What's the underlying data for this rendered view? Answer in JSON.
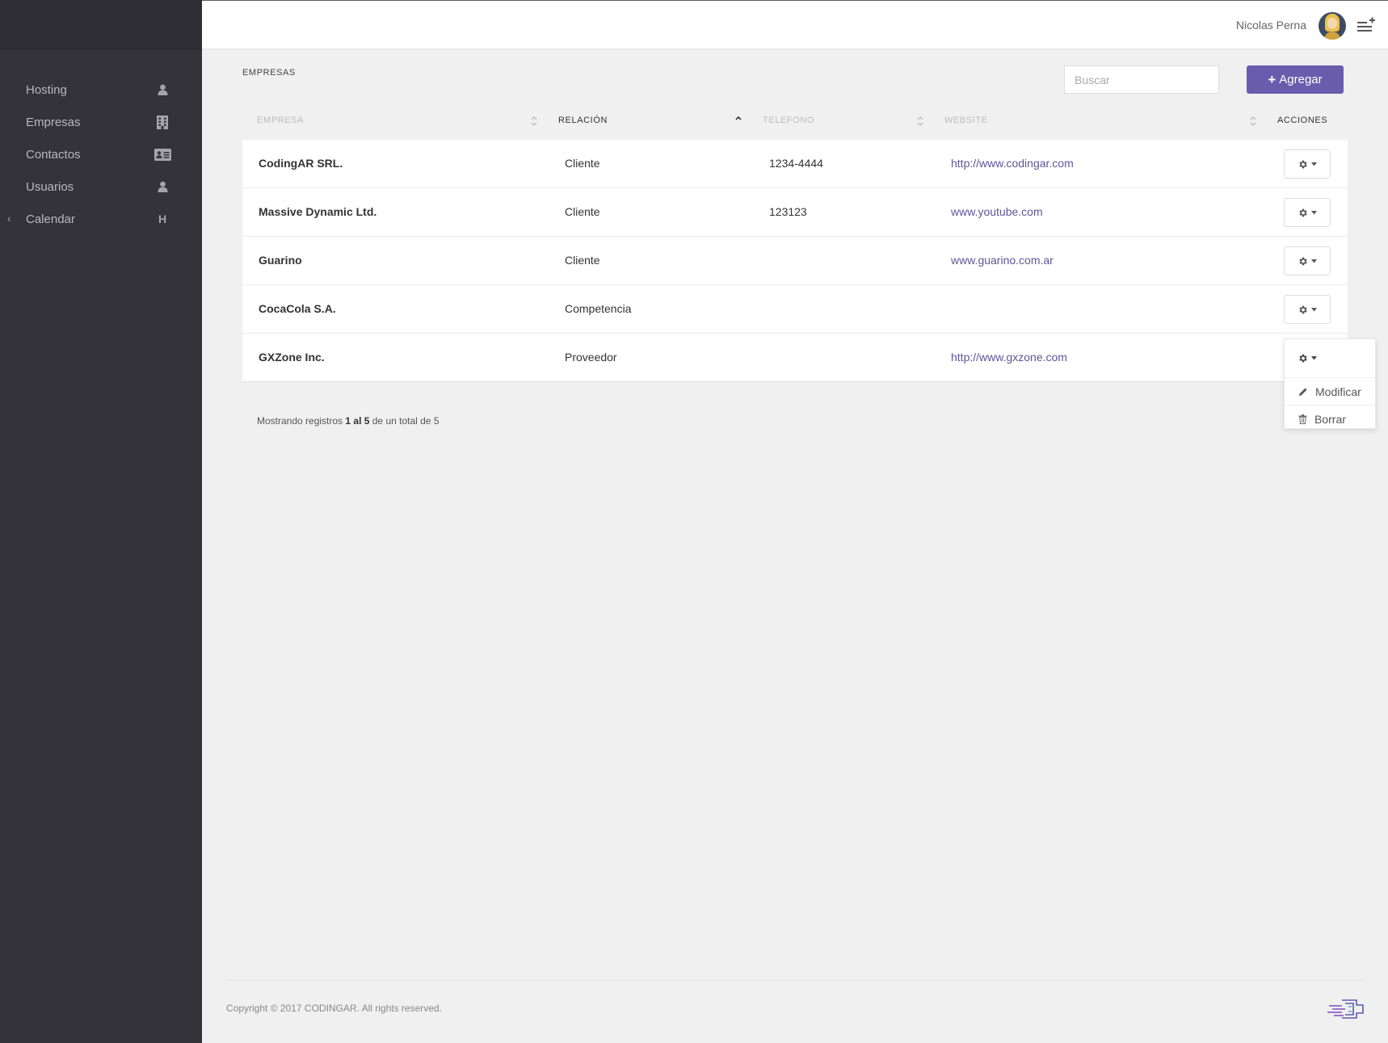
{
  "user": {
    "name": "Nicolas Perna"
  },
  "sidebar": {
    "items": [
      {
        "label": "Hosting",
        "icon": "user-icon"
      },
      {
        "label": "Empresas",
        "icon": "building-icon"
      },
      {
        "label": "Contactos",
        "icon": "address-card-icon"
      },
      {
        "label": "Usuarios",
        "icon": "user-icon"
      },
      {
        "label": "Calendar",
        "icon": "letter-h-icon",
        "icon_text": "H",
        "caret": "‹"
      }
    ]
  },
  "page": {
    "title": "EMPRESAS",
    "search_placeholder": "Buscar",
    "add_label": "Agregar",
    "add_icon": "+"
  },
  "table": {
    "headers": {
      "empresa": "EMPRESA",
      "relacion": "RELACIÓN",
      "telefono": "TELEFONO",
      "website": "WEBSITE",
      "acciones": "ACCIONES"
    },
    "sorted_column": "relacion",
    "sort_direction": "ascending",
    "rows": [
      {
        "empresa": "CodingAR SRL.",
        "relacion": "Cliente",
        "telefono": "1234-4444",
        "website": "http://www.codingar.com"
      },
      {
        "empresa": "Massive Dynamic Ltd.",
        "relacion": "Cliente",
        "telefono": "123123",
        "website": "www.youtube.com"
      },
      {
        "empresa": "Guarino",
        "relacion": "Cliente",
        "telefono": "",
        "website": "www.guarino.com.ar"
      },
      {
        "empresa": "CocaCola S.A.",
        "relacion": "Competencia",
        "telefono": "",
        "website": ""
      },
      {
        "empresa": "GXZone Inc.",
        "relacion": "Proveedor",
        "telefono": "",
        "website": "http://www.gxzone.com"
      }
    ],
    "open_dropdown_row": 4
  },
  "actions_menu": {
    "modify_label": "Modificar",
    "delete_label": "Borrar"
  },
  "pagination": {
    "prefix": "Mostrando registros ",
    "range": "1 al 5",
    "suffix": " de un total de 5"
  },
  "footer": {
    "copyright": "Copyright © 2017 CODINGAR. All rights reserved."
  },
  "colors": {
    "sidebar": "#34333a",
    "accent": "#6a5cad",
    "link": "#5e5699"
  }
}
